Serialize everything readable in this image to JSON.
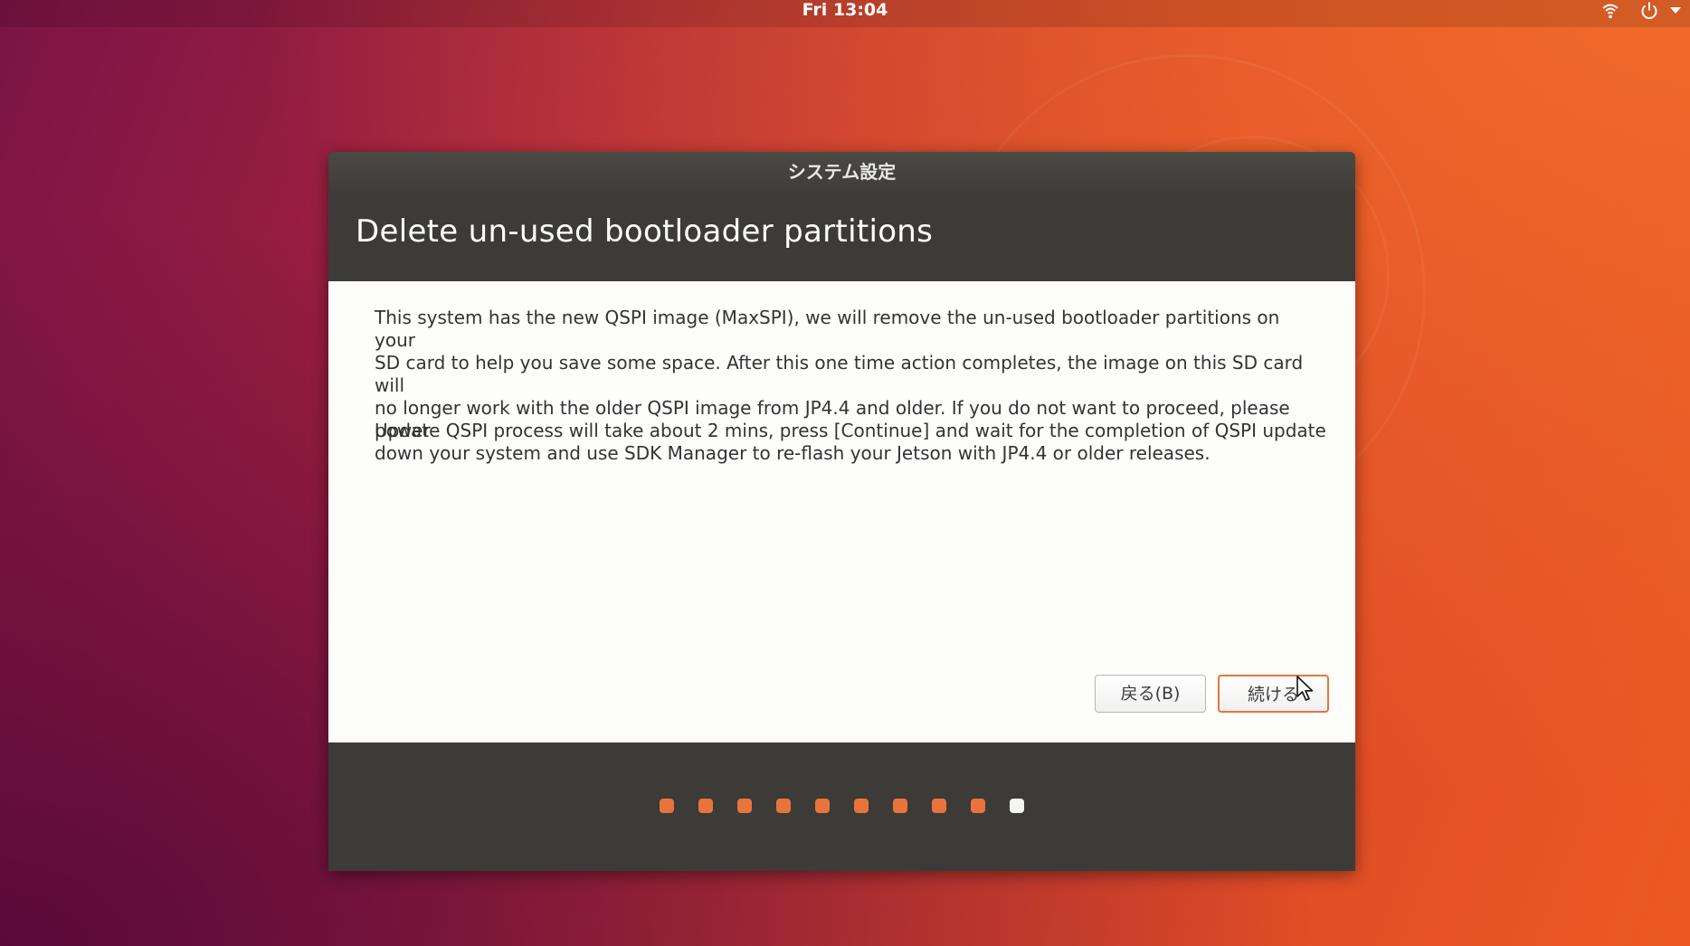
{
  "topbar": {
    "clock": "Fri 13:04",
    "icons": [
      "wifi-icon",
      "power-icon",
      "chevron-down-icon"
    ]
  },
  "dialog": {
    "window_title": "システム設定",
    "heading": "Delete un-used bootloader partitions",
    "paragraph1_lines": [
      "This system has the new QSPI image (MaxSPI), we will remove the un-used bootloader partitions on your",
      "SD card to help you save some space. After this one time action completes, the image on this SD card will",
      "no longer work with the older QSPI image from JP4.4 and older. If you do not want to proceed, please power",
      "down your system and use SDK Manager to re-flash your Jetson with JP4.4 or older releases."
    ],
    "paragraph2": "Update QSPI process will take about 2 mins, press [Continue] and wait for the completion of QSPI update",
    "back_button": "戻る(B)",
    "continue_button": "続ける",
    "progress": {
      "total_steps": 10,
      "current_step": 10
    }
  },
  "colors": {
    "accent": "#e9733c",
    "dialog_dark": "#3c3b37",
    "content_bg": "#fdfdfc",
    "current_dot": "#f4f4f2"
  }
}
